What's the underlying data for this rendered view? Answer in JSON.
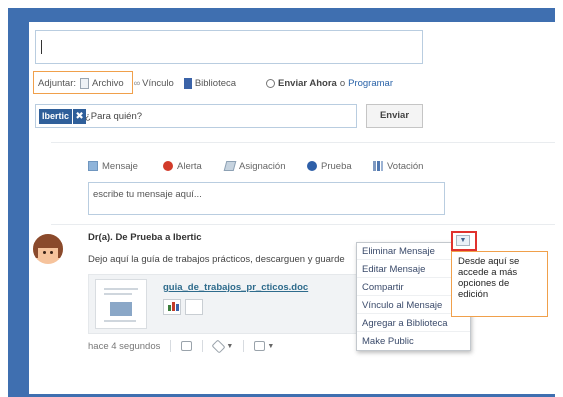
{
  "composer": {
    "attach_label": "Adjuntar:",
    "file_label": "Archivo",
    "link_label": "Vínculo",
    "library_label": "Biblioteca",
    "send_now_label": "Enviar Ahora",
    "or_label": "o",
    "schedule_label": "Programar",
    "recipient_chip": "Ibertic",
    "recipient_placeholder": "¿Para quién?",
    "send_label": "Enviar"
  },
  "message_tabs": [
    {
      "label": "Mensaje",
      "icon": "message-icon"
    },
    {
      "label": "Alerta",
      "icon": "alert-icon"
    },
    {
      "label": "Asignación",
      "icon": "assignment-icon"
    },
    {
      "label": "Prueba",
      "icon": "quiz-icon"
    },
    {
      "label": "Votación",
      "icon": "poll-icon"
    }
  ],
  "message_placeholder": "escribe tu mensaje aquí...",
  "post": {
    "header": "Dr(a). De Prueba a Ibertic",
    "text": "Dejo aquí la guía de trabajos prácticos, descarguen y guarde",
    "attachment_name": "guia_de_trabajos_pr_cticos.doc",
    "timestamp": "hace 4 segundos"
  },
  "menu": {
    "items": [
      "Eliminar Mensaje",
      "Editar Mensaje",
      "Compartir",
      "Vínculo al Mensaje",
      "Agregar a Biblioteca",
      "Make Public"
    ]
  },
  "callout": {
    "text": "Desde aquí se accede a más opciones de edición"
  },
  "colors": {
    "frame": "#3f6fb0",
    "highlight_orange": "#f0a04b",
    "highlight_red": "#e0322e",
    "chip": "#2f5f9a"
  }
}
